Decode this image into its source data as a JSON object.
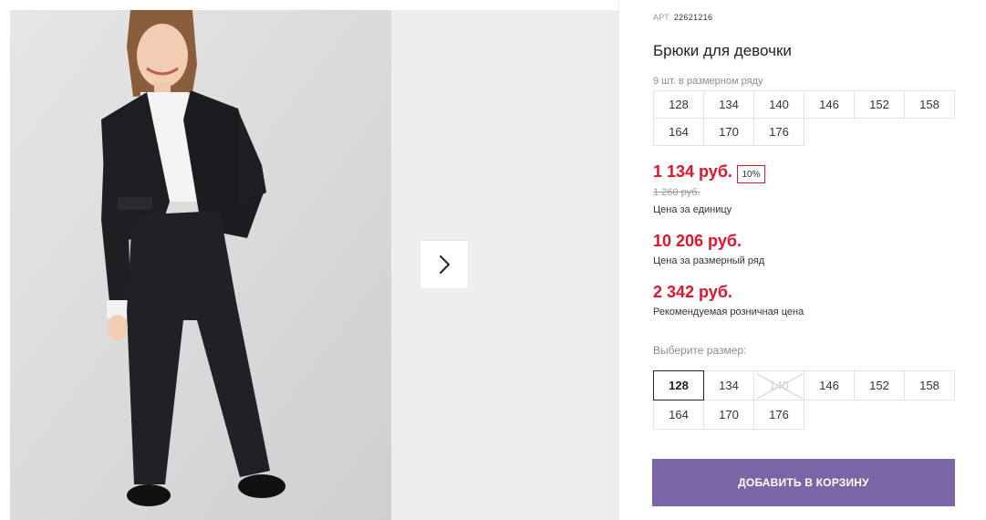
{
  "product": {
    "article_label": "АРТ.",
    "article_number": "22621216",
    "title": "Брюки для девочки",
    "pack_info": "9 шт. в размерном ряду",
    "pack_sizes": [
      "128",
      "134",
      "140",
      "146",
      "152",
      "158",
      "164",
      "170",
      "176"
    ]
  },
  "pricing": {
    "unit_price": "1 134 руб.",
    "discount_badge": "10%",
    "old_price": "1 260 руб.",
    "unit_caption": "Цена за единицу",
    "pack_price": "10 206 руб.",
    "pack_caption": "Цена за размерный ряд",
    "retail_price": "2 342 руб.",
    "retail_caption": "Рекомендуемая розничная цена"
  },
  "size_selector": {
    "label": "Выберите размер:",
    "sizes": [
      {
        "label": "128",
        "state": "selected"
      },
      {
        "label": "134",
        "state": "available"
      },
      {
        "label": "140",
        "state": "unavailable"
      },
      {
        "label": "146",
        "state": "available"
      },
      {
        "label": "152",
        "state": "available"
      },
      {
        "label": "158",
        "state": "available"
      },
      {
        "label": "164",
        "state": "available"
      },
      {
        "label": "170",
        "state": "available"
      },
      {
        "label": "176",
        "state": "available"
      }
    ]
  },
  "actions": {
    "add_to_cart": "ДОБАВИТЬ В КОРЗИНУ"
  },
  "gallery": {
    "next_icon": "chevron-right-icon"
  },
  "colors": {
    "price_red": "#e0142b",
    "cart_purple": "#7a65a7"
  }
}
